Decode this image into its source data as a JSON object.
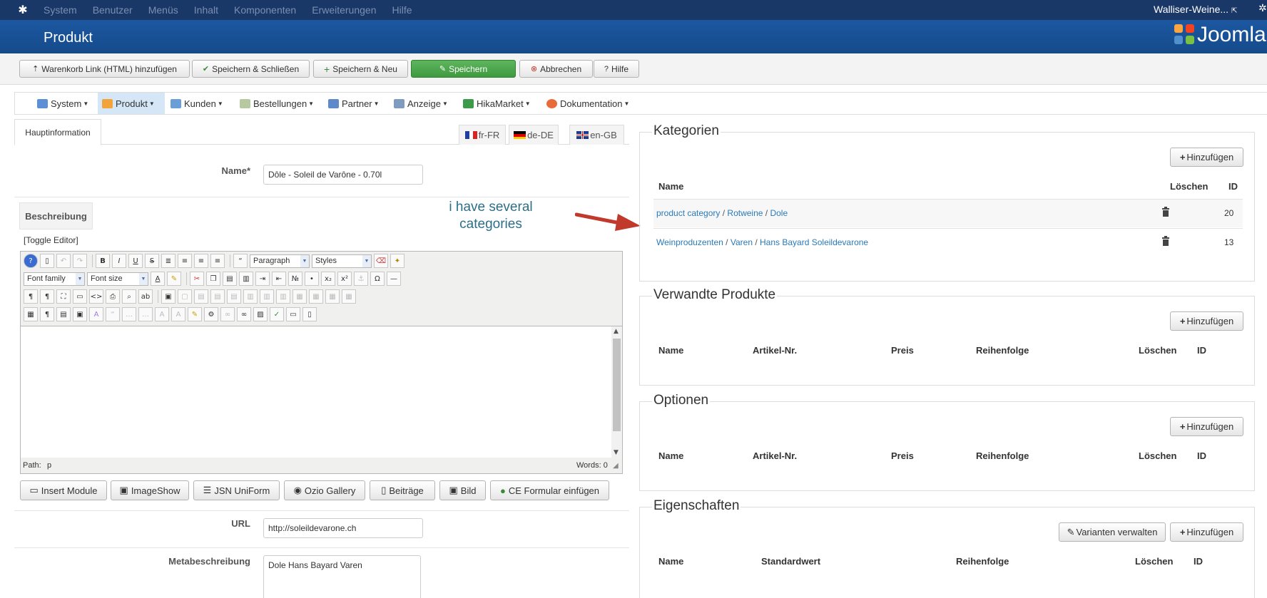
{
  "topbar": {
    "menu": [
      "System",
      "Benutzer",
      "Menüs",
      "Inhalt",
      "Komponenten",
      "Erweiterungen",
      "Hilfe"
    ],
    "site_name": "Walliser-Weine..."
  },
  "titlebar": {
    "title": "Produkt",
    "logo_text": "Joomla"
  },
  "toolbar": {
    "cart_link": "Warenkorb Link (HTML) hinzufügen",
    "save_close": "Speichern & Schließen",
    "save_new": "Speichern & Neu",
    "save": "Speichern",
    "cancel": "Abbrechen",
    "help": "Hilfe"
  },
  "hikamenu": {
    "items": [
      "System",
      "Produkt",
      "Kunden",
      "Bestellungen",
      "Partner",
      "Anzeige",
      "HikaMarket",
      "Dokumentation"
    ],
    "active": "Produkt"
  },
  "tabs": {
    "main": "Hauptinformation",
    "languages": [
      "fr-FR",
      "de-DE",
      "en-GB"
    ]
  },
  "form": {
    "name_label": "Name*",
    "name_value": "Dôle - Soleil de Varône - 0.70l",
    "desc_label": "Beschreibung",
    "toggle_editor": "[Toggle Editor]",
    "url_label": "URL",
    "url_value": "http://soleildevarone.ch",
    "meta_label": "Metabeschreibung",
    "meta_value": "Dole Hans Bayard Varen"
  },
  "editor": {
    "paragraph": "Paragraph",
    "styles": "Styles",
    "font_family": "Font family",
    "font_size": "Font size",
    "path_label": "Path:",
    "path_value": "p",
    "words": "Words: 0"
  },
  "editor_buttons": [
    "Insert Module",
    "ImageShow",
    "JSN UniForm",
    "Ozio Gallery",
    "Beiträge",
    "Bild",
    "CE Formular einfügen"
  ],
  "annotation": {
    "line1": "i have several",
    "line2": "categories"
  },
  "categories": {
    "title": "Kategorien",
    "add": "Hinzufügen",
    "headers": {
      "name": "Name",
      "delete": "Löschen",
      "id": "ID"
    },
    "rows": [
      {
        "path": [
          "product category",
          "Rotweine",
          "Dole"
        ],
        "id": "20"
      },
      {
        "path": [
          "Weinproduzenten",
          "Varen",
          "Hans Bayard Soleildevarone"
        ],
        "id": "13"
      }
    ]
  },
  "related": {
    "title": "Verwandte Produkte",
    "add": "Hinzufügen",
    "headers": {
      "name": "Name",
      "sku": "Artikel-Nr.",
      "price": "Preis",
      "order": "Reihenfolge",
      "delete": "Löschen",
      "id": "ID"
    }
  },
  "options": {
    "title": "Optionen",
    "add": "Hinzufügen",
    "headers": {
      "name": "Name",
      "sku": "Artikel-Nr.",
      "price": "Preis",
      "order": "Reihenfolge",
      "delete": "Löschen",
      "id": "ID"
    }
  },
  "properties": {
    "title": "Eigenschaften",
    "variants": "Varianten verwalten",
    "add": "Hinzufügen",
    "headers": {
      "name": "Name",
      "default": "Standardwert",
      "order": "Reihenfolge",
      "delete": "Löschen",
      "id": "ID"
    }
  },
  "colors": {
    "topbar": "#1a3867",
    "titlebar": "#1c57a0",
    "save_green": "#4aa94a",
    "link": "#2a7ab8",
    "annotation": "#2d6f88",
    "arrow": "#c0392b"
  }
}
